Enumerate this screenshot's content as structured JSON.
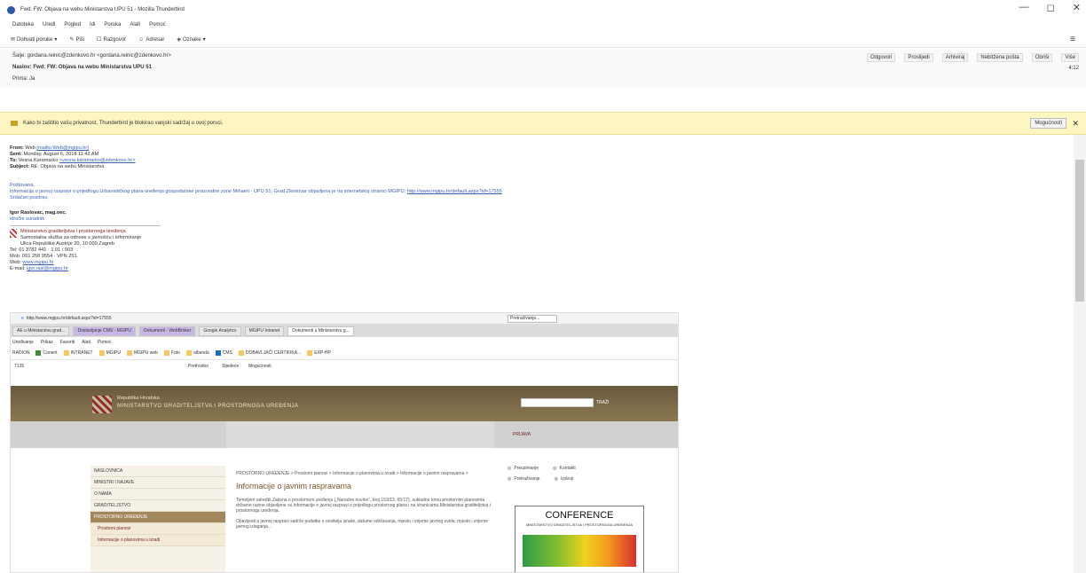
{
  "window": {
    "title": "Fwd: FW: Objava na webu Ministarstva UPU 51 - Mozilla Thunderbird",
    "controls": [
      "—",
      "◻",
      "✕"
    ]
  },
  "menubar": [
    "Datoteka",
    "Uredi",
    "Pogled",
    "Idi",
    "Poruka",
    "Alati",
    "Pomoć"
  ],
  "toolbar": {
    "items": [
      {
        "icon": "mail-icon",
        "label": "Dohvati poruke"
      },
      {
        "icon": "pencil-icon",
        "label": "Piši"
      },
      {
        "icon": "chat-icon",
        "label": "Razgovor"
      },
      {
        "icon": "address-book-icon",
        "label": "Adresar"
      },
      {
        "icon": "tag-icon",
        "label": "Oznake"
      }
    ],
    "menu_icon": "≡"
  },
  "message_header": {
    "from": "Šalje: gordana.reinic@zdenkovo.hr <gordana.reinic@zdenkovo.hr>",
    "subject": "Naslov: Fwd: FW: Objava na webu Ministarstva UPU 51",
    "to": "Prima: Ja",
    "date": "4:12",
    "actions": [
      "Odgovori",
      "Proslijedi",
      "Arhiviraj",
      "Nebitžena pošta",
      "Obriši",
      "Više"
    ]
  },
  "notice": {
    "text": "Kako bi zaštitio vašu privatnost, Thunderbird je blokirao vanjski sadržaj u ovoj poruci.",
    "button": "Mogućnosti"
  },
  "email": {
    "from_label": "From:",
    "from_name": "Web",
    "from_addr": "[mailto:Web@mgipu.hr]",
    "sent_label": "Sent:",
    "sent": "Monday, August 6, 2018 11:42 AM",
    "to_label": "To:",
    "to_name": "Vesna Karamarko",
    "to_addr": "<vesna.karamarko@zdenkovo.hr>",
    "subject_label": "Subject:",
    "subject": "RE: Objava na webu Ministarstva",
    "greeting": "Poštovana,",
    "body": "informacija o javnoj raspravi o prijedlogu Urbanističkog plana uređenja gospodarske proizvodne zone Mihaeri - UPU 51, Grad Zlentovar objavljena je na internetskoj stranici MGIPU:",
    "link": "http://www.mgipu.hr/default.aspx?id=17555",
    "closing": "Srdačan pozdrav,",
    "signer": "Igor Raslovac, mag.oec.",
    "signer_title": "stručni suradnik",
    "org_name": "Ministarstvo graditeljstva i prostornoga uređenja",
    "org_unit": "Samostalna služba za odnose s javnošću i informiranje",
    "org_addr": "Ulica Republike Austrije 20, 10 000 Zagreb",
    "tel": "Tel: 01 3782 441 · 1.01 / 003",
    "mob": "Mob: 091 258 9554 · VPN 251",
    "web_label": "Web:",
    "web": "www.mgipu.hr",
    "email_label": "E-mail:",
    "email": "igor.rasl@mgipu.hr"
  },
  "embedded_browser": {
    "url": "http://www.mgipu.hr/default.aspx?id=17555",
    "search_placeholder": "Pretraživanje...",
    "tabs": [
      {
        "label": "AE u Ministarstvu grad...",
        "style": "normal"
      },
      {
        "label": "Dostavljanje CMS - MGIPU",
        "style": "hl"
      },
      {
        "label": "Dokumenti - WebBroker",
        "style": "hl"
      },
      {
        "label": "Google Analytics",
        "style": "normal"
      },
      {
        "label": "MGIPU Intranet",
        "style": "normal"
      },
      {
        "label": "Dokumenti u Ministarstvu g...",
        "style": "active"
      }
    ],
    "ie_menu": [
      "Uređivanje",
      "Prikaz",
      "Favoriti",
      "Alati",
      "Pomoć"
    ],
    "favorites": [
      "RADION",
      "Conent",
      "INTRANET",
      "MGIPU",
      "MGIPU web",
      "Foto",
      "albunda",
      "CMS",
      "DOBAVLJAČI CERTIFIKA...",
      "EXP-HP"
    ],
    "find_bar": {
      "query": "7135",
      "prev": "Prethodno",
      "next": "Sljedeće",
      "options": "Mogućnosti"
    },
    "site_title_small": "Republika Hrvatska",
    "site_title": "MINISTARSTVO GRADITELJSTVA I PROSTORNOGA UREĐENJA",
    "search_btn": "TRAŽI",
    "login": "PRIJAVA",
    "sidebar": [
      {
        "label": "NASLOVNICA",
        "style": "normal"
      },
      {
        "label": "MINISTRI I NAJAVE",
        "style": "normal"
      },
      {
        "label": "O NAMA",
        "style": "normal"
      },
      {
        "label": "GRADITELJSTVO",
        "style": "normal"
      },
      {
        "label": "PROSTORNO UREĐENJE",
        "style": "sel"
      },
      {
        "label": "Prostorni planovi",
        "style": "sub"
      },
      {
        "label": "Informacije o planovima u izradi",
        "style": "sub"
      }
    ],
    "breadcrumb": "PROSTORNO UREĐENJE > Prostorni planovi > Informacije o planovima u izradi > Informacije o javnim raspravama >",
    "page_title": "Informacije o javnim raspravama",
    "para1": "Temeljem odredbi Zakona o prostornom uređenju („Narodne novine“, broj 153/13, 65/17), sukladno tomu prostornim planovima državne razine objavljene su informacije o javnoj raspravi o prijedlogu prostornog plana i na stranicama Ministarstva graditeljstva i prostornoga uređenja.",
    "para2": "Obavijesti o javnoj raspravi sadrže podatke o nositelju izrade, datume održavanja, mjesto i vrijeme javnog uvida, mjesto i vrijeme javnog izlaganja...",
    "right_buttons": [
      "Preuzimanje",
      "Kontakti",
      "Pretraživanje",
      "Izdvoji"
    ],
    "conference_title": "CONFERENCE",
    "conference_sub": "MINISTARSTVO GRADITELJSTVA I PROSTORNOGA UREĐENJA"
  }
}
